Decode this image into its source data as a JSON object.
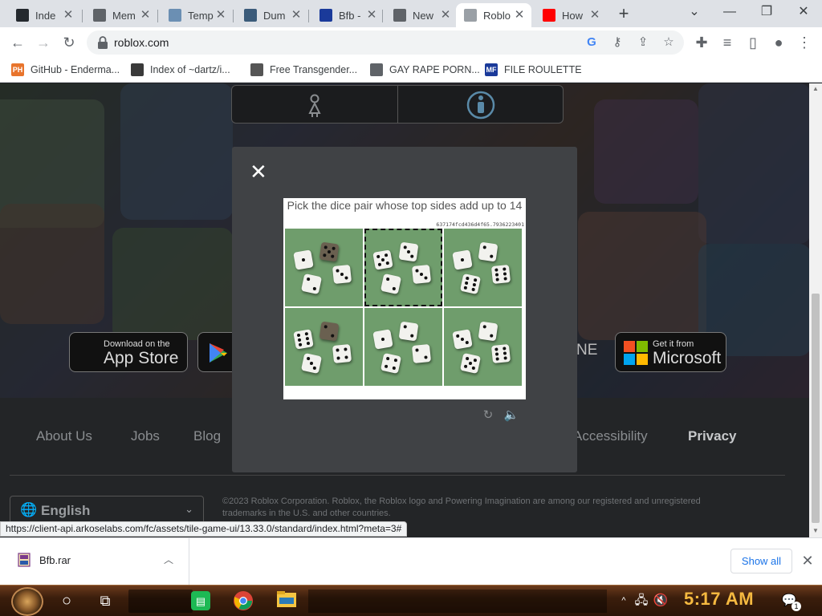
{
  "browser": {
    "tabs": [
      {
        "label": "Inde",
        "icon": "github-icon",
        "favicon_color": "#24292e"
      },
      {
        "label": "Mem",
        "icon": "globe-icon",
        "favicon_color": "#5f6368"
      },
      {
        "label": "Temp",
        "icon": "mail-icon",
        "favicon_color": "#6b8fb3"
      },
      {
        "label": "Dum",
        "icon": "link-icon",
        "favicon_color": "#3b5b7a"
      },
      {
        "label": "Bfb -",
        "icon": "mf-icon",
        "favicon_color": "#1a3a9a"
      },
      {
        "label": "New",
        "icon": "globe-icon",
        "favicon_color": "#5f6368"
      },
      {
        "label": "Roblo",
        "icon": "roblox-icon",
        "favicon_color": "#9aa0a6",
        "active": true
      },
      {
        "label": "How",
        "icon": "youtube-icon",
        "favicon_color": "#ff0000"
      }
    ],
    "new_tab_label": "+",
    "url": "roblox.com",
    "bookmarks": [
      {
        "label": "GitHub - Enderma...",
        "icon": "ph-icon",
        "icon_text": "PH",
        "color": "#e8742c"
      },
      {
        "label": "Index of ~dartz/i...",
        "icon": "server-icon",
        "icon_text": "",
        "color": "#3a3a3a"
      },
      {
        "label": "Free Transgender...",
        "icon": "mask-icon",
        "icon_text": "",
        "color": "#555555"
      },
      {
        "label": "GAY RAPE PORN...",
        "icon": "globe-icon",
        "icon_text": "",
        "color": "#5f6368"
      },
      {
        "label": "FILE ROULETTE",
        "icon": "mf-icon",
        "icon_text": "MF",
        "color": "#1a3a9a"
      }
    ]
  },
  "page": {
    "footer_links": [
      "About Us",
      "Jobs",
      "Blog",
      "Accessibility",
      "Privacy"
    ],
    "store_buttons": {
      "app_store_small": "Download on the",
      "app_store_big": "App Store",
      "microsoft_small": "Get it from",
      "microsoft_big": "Microsoft",
      "partial_text": "NE"
    },
    "language": "English",
    "copyright_line1": "©2023 Roblox Corporation. Roblox, the Roblox logo and Powering Imagination are among our registered and unregistered",
    "copyright_line2": "trademarks in the U.S. and other countries."
  },
  "captcha": {
    "close_label": "✕",
    "prompt": "Pick the dice pair whose top sides add up to 14",
    "session_id": "637174fcd436d4f65.7936223401",
    "selected_index": 1,
    "cells": [
      {
        "dice": [
          1,
          5,
          3,
          2
        ]
      },
      {
        "dice": [
          5,
          3,
          3,
          2
        ]
      },
      {
        "dice": [
          1,
          2,
          6,
          6
        ]
      },
      {
        "dice": [
          6,
          2,
          4,
          3
        ]
      },
      {
        "dice": [
          1,
          2,
          2,
          4
        ]
      },
      {
        "dice": [
          3,
          2,
          6,
          5
        ]
      }
    ],
    "reload_icon": "↻",
    "audio_icon": "🔈"
  },
  "status_url": "https://client-api.arkoselabs.com/fc/assets/tile-game-ui/13.33.0/standard/index.html?meta=3#",
  "downloads": {
    "filename": "Bfb.rar",
    "show_all": "Show all"
  },
  "taskbar": {
    "clock": "5:17 AM",
    "notification_count": "1"
  }
}
